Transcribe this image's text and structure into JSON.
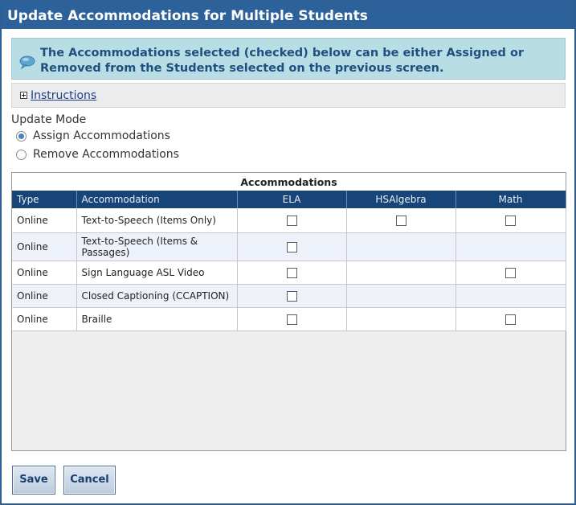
{
  "dialog": {
    "title": "Update Accommodations for Multiple Students",
    "info_line1": "The Accommodations selected (checked) below can be either Assigned or",
    "info_line2": "Removed from the Students selected on the previous screen.",
    "instructions_link": "Instructions"
  },
  "mode": {
    "label": "Update Mode",
    "options": [
      {
        "label": "Assign Accommodations",
        "selected": true
      },
      {
        "label": "Remove Accommodations",
        "selected": false
      }
    ]
  },
  "table": {
    "caption": "Accommodations",
    "headers": [
      "Type",
      "Accommodation",
      "ELA",
      "HSAlgebra",
      "Math"
    ],
    "rows": [
      {
        "type": "Online",
        "accommodation": "Text-to-Speech (Items Only)",
        "ela": "checkbox",
        "hsalgebra": "checkbox",
        "math": "checkbox"
      },
      {
        "type": "Online",
        "accommodation_line1": "Text-to-Speech (Items &",
        "accommodation_line2": "Passages)",
        "ela": "checkbox",
        "hsalgebra": "",
        "math": ""
      },
      {
        "type": "Online",
        "accommodation": "Sign Language ASL Video",
        "ela": "checkbox",
        "hsalgebra": "",
        "math": "checkbox"
      },
      {
        "type": "Online",
        "accommodation": "Closed Captioning (CCAPTION)",
        "ela": "checkbox",
        "hsalgebra": "",
        "math": ""
      },
      {
        "type": "Online",
        "accommodation": "Braille",
        "ela": "checkbox",
        "hsalgebra": "",
        "math": "checkbox"
      }
    ]
  },
  "buttons": {
    "save": "Save",
    "cancel": "Cancel"
  },
  "colors": {
    "titlebar": "#2c6199",
    "header_row": "#17457a",
    "info_bg": "#b9dde5"
  },
  "icons": {
    "info": "speech-bubble-icon",
    "expand": "plus-box-icon"
  }
}
